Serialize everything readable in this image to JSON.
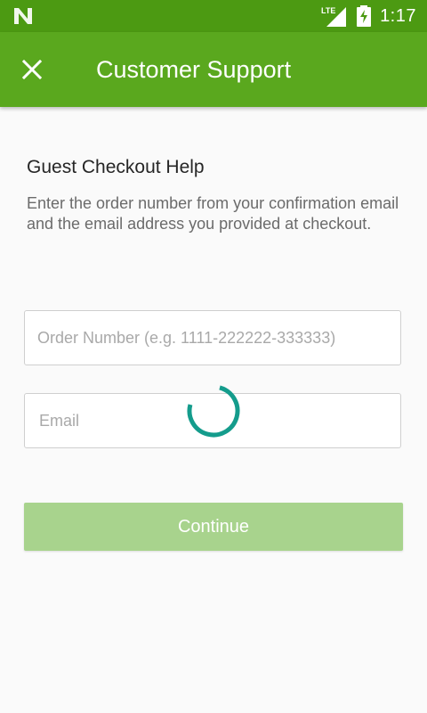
{
  "status_bar": {
    "time": "1:17",
    "network_label": "LTE",
    "icons": [
      "n-notification-icon",
      "lte-signal-icon",
      "battery-charging-icon"
    ]
  },
  "app_bar": {
    "title": "Customer Support",
    "close_icon": "close-icon"
  },
  "main": {
    "heading": "Guest Checkout Help",
    "description": "Enter the order number from your confirmation email and the email address you provided at checkout.",
    "order_field": {
      "placeholder": "Order Number (e.g. 1111-222222-333333)",
      "value": ""
    },
    "email_field": {
      "placeholder": "Email",
      "value": ""
    },
    "continue_label": "Continue",
    "loading_indicator": "progress-spinner-icon"
  },
  "colors": {
    "status_bar": "#4c9a12",
    "app_bar": "#5aa81e",
    "button_disabled": "#a8d38d",
    "spinner": "#149c8c",
    "background": "#fafafa"
  }
}
